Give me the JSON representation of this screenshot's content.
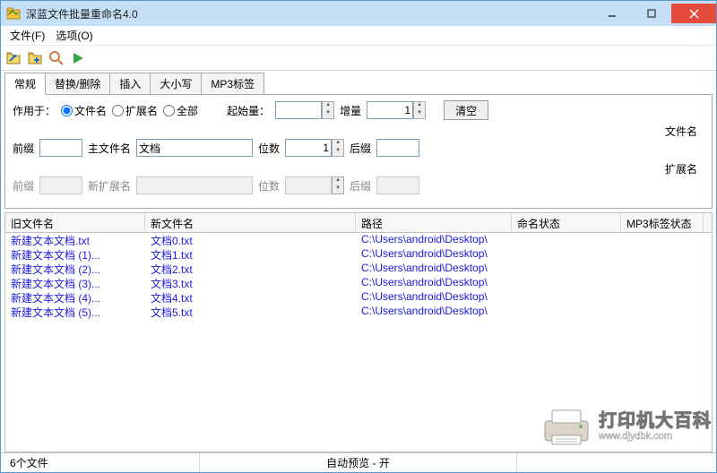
{
  "window": {
    "title": "深蓝文件批量重命名4.0"
  },
  "menu": {
    "file": "文件(F)",
    "options": "选项(O)"
  },
  "tabs": [
    "常规",
    "替换/删除",
    "插入",
    "大小写",
    "MP3标签"
  ],
  "active_tab": 0,
  "panel": {
    "apply_to": "作用于：",
    "apply_options": [
      "文件名",
      "扩展名",
      "全部"
    ],
    "apply_selected": 0,
    "start": "起始量：",
    "start_val": "",
    "step": "增量",
    "step_val": "1",
    "clear": "清空",
    "file_label": "文件名",
    "ext_label": "扩展名",
    "prefix": "前缀",
    "prefix_val": "",
    "mainfile": "主文件名",
    "mainfile_val": "文档",
    "digits": "位数",
    "digits_val": "1",
    "suffix": "后缀",
    "suffix_val": "",
    "new_ext": "新扩展名",
    "new_ext_val": ""
  },
  "columns": [
    "旧文件名",
    "新文件名",
    "路径",
    "命名状态",
    "MP3标签状态"
  ],
  "rows": [
    {
      "old": "新建文本文档.txt",
      "new": "文档0.txt",
      "path": "C:\\Users\\android\\Desktop\\",
      "s1": "",
      "s2": ""
    },
    {
      "old": "新建文本文档 (1)...",
      "new": "文档1.txt",
      "path": "C:\\Users\\android\\Desktop\\",
      "s1": "",
      "s2": ""
    },
    {
      "old": "新建文本文档 (2)...",
      "new": "文档2.txt",
      "path": "C:\\Users\\android\\Desktop\\",
      "s1": "",
      "s2": ""
    },
    {
      "old": "新建文本文档 (3)...",
      "new": "文档3.txt",
      "path": "C:\\Users\\android\\Desktop\\",
      "s1": "",
      "s2": ""
    },
    {
      "old": "新建文本文档 (4)...",
      "new": "文档4.txt",
      "path": "C:\\Users\\android\\Desktop\\",
      "s1": "",
      "s2": ""
    },
    {
      "old": "新建文本文档 (5)...",
      "new": "文档5.txt",
      "path": "C:\\Users\\android\\Desktop\\",
      "s1": "",
      "s2": ""
    }
  ],
  "status": {
    "count": "6个文件",
    "preview": "自动预览 - 开"
  },
  "watermark": {
    "title": "打印机大百科",
    "url": "www.djydbk.com"
  }
}
